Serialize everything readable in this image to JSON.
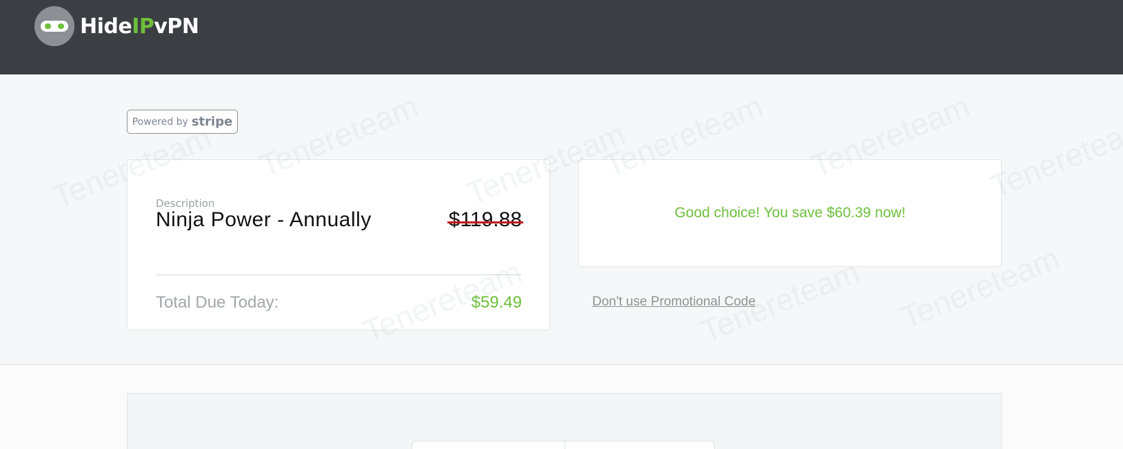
{
  "header": {
    "logo": {
      "icon": "ninja-mask-icon",
      "text_prefix": "Hide",
      "text_ip": "IP",
      "text_suffix": "vPN"
    }
  },
  "badge": {
    "powered_by": "Powered by",
    "provider": "stripe"
  },
  "order": {
    "description_label": "Description",
    "product": "Ninja Power - Annually",
    "original_price": "$119.88",
    "total_label": "Total Due Today:",
    "total_value": "$59.49"
  },
  "promo": {
    "message": "Good choice! You save $60.39 now!",
    "remove_link": "Don't use Promotional Code"
  },
  "watermark": "Tenereteam",
  "colors": {
    "header_bg": "#3b3e43",
    "accent_green": "#6dbf3b",
    "strike_red": "#c4161c"
  }
}
